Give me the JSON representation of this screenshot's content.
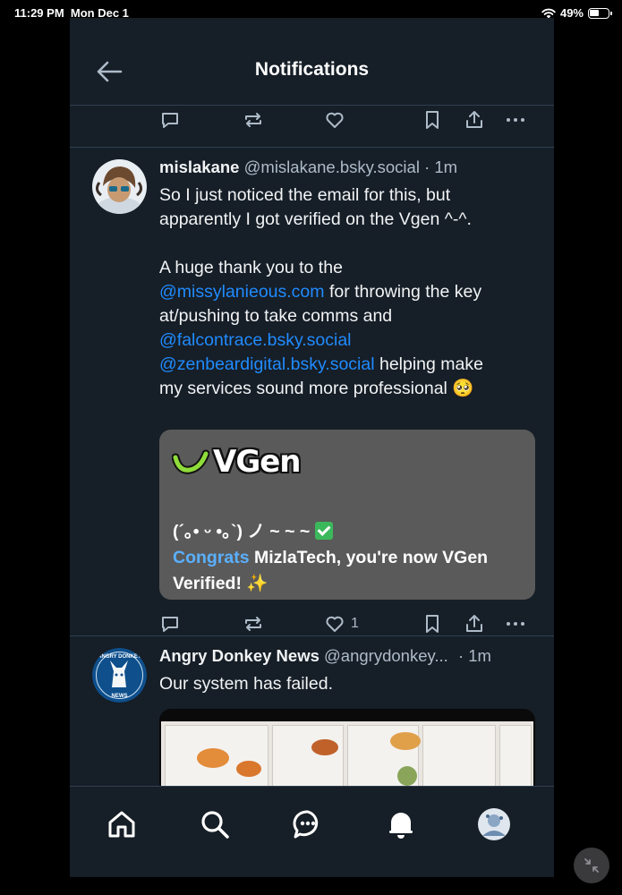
{
  "status_bar": {
    "time": "11:29 PM",
    "date": "Mon Dec 1",
    "battery": "49%"
  },
  "header": {
    "title": "Notifications"
  },
  "colors": {
    "background": "#161e27",
    "mention": "#208bfe",
    "muted": "#aebbc9",
    "divider": "#2e4052"
  },
  "posts": [
    {
      "author_name": "mislakane",
      "author_handle": "@mislakane.bsky.social · 1m",
      "text_line1": "So I just noticed the email for this, but",
      "text_line2": "apparently I got verified on the Vgen ^-^.",
      "text_p2_a": "A huge thank you to the",
      "mention1": "@missylanieous.com",
      "text_p2_b": " for throwing the key",
      "text_p2_c": "at/pushing to take comms and",
      "mention2": "@falcontrace.bsky.social",
      "mention3": "@zenbeardigital.bsky.social",
      "text_p2_d": " helping make",
      "text_p2_e": "my services sound more professional 🥺",
      "embed": {
        "logo_text": "VGen",
        "kaomoji": "(´｡• ᵕ •｡`) ノ ~ ~ ~",
        "congrats": "Congrats",
        "message_a": " MizlaTech, you're now VGen",
        "message_b": "Verified! ✨"
      },
      "like_count": "1"
    },
    {
      "author_name": "Angry Donkey News",
      "author_handle": "@angrydonkey...",
      "time": "· 1m",
      "text": "Our system has failed.",
      "avatar_text": "ANGRY DONKEY",
      "avatar_text2": "NEWS"
    }
  ],
  "icons": [
    "back-arrow-icon",
    "reply-icon",
    "repost-icon",
    "like-icon",
    "bookmark-icon",
    "share-icon",
    "more-icon",
    "home-icon",
    "search-icon",
    "chat-icon",
    "bell-icon",
    "profile-avatar",
    "minimize-icon"
  ]
}
